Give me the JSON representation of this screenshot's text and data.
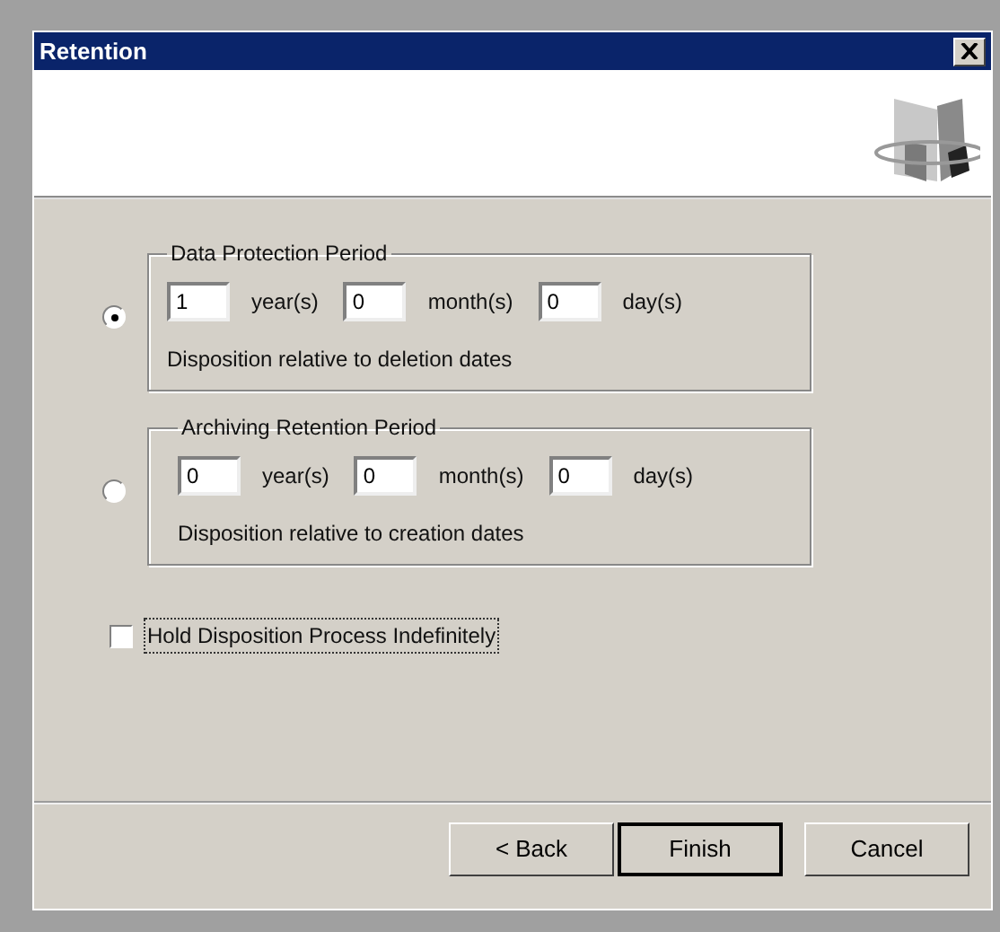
{
  "window": {
    "title": "Retention"
  },
  "periods": [
    {
      "title": "Data Protection Period",
      "selected": true,
      "fields": [
        {
          "value": "1",
          "unit": "year(s)"
        },
        {
          "value": "0",
          "unit": "month(s)"
        },
        {
          "value": "0",
          "unit": "day(s)"
        }
      ],
      "note": "Disposition relative to deletion dates"
    },
    {
      "title": "Archiving Retention Period",
      "selected": false,
      "fields": [
        {
          "value": "0",
          "unit": "year(s)"
        },
        {
          "value": "0",
          "unit": "month(s)"
        },
        {
          "value": "0",
          "unit": "day(s)"
        }
      ],
      "note": "Disposition relative to creation dates"
    }
  ],
  "hold": {
    "label": "Hold Disposition Process Indefinitely",
    "checked": false,
    "focused": true
  },
  "buttons": [
    {
      "label": "< Back",
      "default": false
    },
    {
      "label": "Finish",
      "default": true
    },
    {
      "label": "Cancel",
      "default": false
    }
  ]
}
